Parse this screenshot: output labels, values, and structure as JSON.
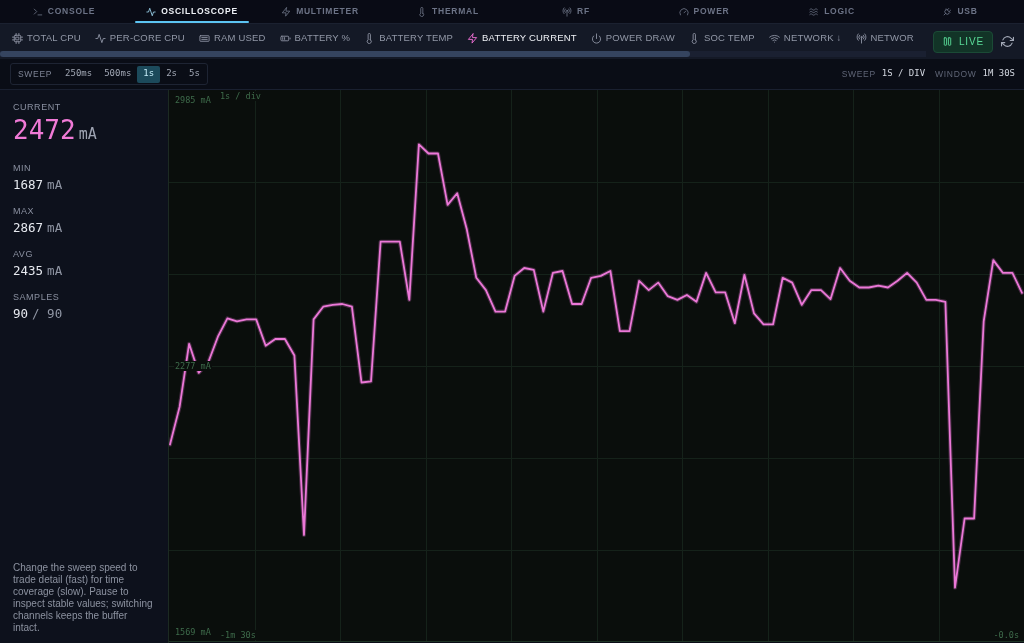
{
  "nav_tabs": [
    {
      "label": "CONSOLE",
      "selected": false
    },
    {
      "label": "OSCILLOSCOPE",
      "selected": true
    },
    {
      "label": "MULTIMETER",
      "selected": false
    },
    {
      "label": "THERMAL",
      "selected": false
    },
    {
      "label": "RF",
      "selected": false
    },
    {
      "label": "POWER",
      "selected": false
    },
    {
      "label": "LOGIC",
      "selected": false
    },
    {
      "label": "USB",
      "selected": false
    }
  ],
  "channels": [
    {
      "label": "TOTAL CPU",
      "selected": false
    },
    {
      "label": "PER-CORE CPU",
      "selected": false
    },
    {
      "label": "RAM USED",
      "selected": false
    },
    {
      "label": "BATTERY %",
      "selected": false
    },
    {
      "label": "BATTERY TEMP",
      "selected": false
    },
    {
      "label": "BATTERY CURRENT",
      "selected": true
    },
    {
      "label": "POWER DRAW",
      "selected": false
    },
    {
      "label": "SOC TEMP",
      "selected": false
    },
    {
      "label": "NETWORK ↓",
      "selected": false
    },
    {
      "label": "NETWOR",
      "selected": false
    }
  ],
  "live_button": {
    "label": "LIVE",
    "active": true
  },
  "sweep": {
    "label": "SWEEP",
    "options": [
      {
        "label": "250ms",
        "selected": false
      },
      {
        "label": "500ms",
        "selected": false
      },
      {
        "label": "1s",
        "selected": true
      },
      {
        "label": "2s",
        "selected": false
      },
      {
        "label": "5s",
        "selected": false
      }
    ]
  },
  "scale_info": [
    {
      "label": "SWEEP",
      "value": "1S / DIV"
    },
    {
      "label": "WINDOW",
      "value": "1M 30S"
    }
  ],
  "stats": {
    "current": {
      "label": "CURRENT",
      "value": "2472",
      "unit": "mA"
    },
    "items": [
      {
        "label": "MIN",
        "value": "1687",
        "unit": "mA"
      },
      {
        "label": "MAX",
        "value": "2867",
        "unit": "mA"
      },
      {
        "label": "AVG",
        "value": "2435",
        "unit": "mA"
      },
      {
        "label": "SAMPLES",
        "value": "90",
        "unit": "/ 90"
      }
    ]
  },
  "help_text": "Change the sweep speed to trade detail (fast) for time coverage (slow). Pause to inspect stable values; switching channels keeps the buffer intact.",
  "chart": {
    "time_labels": [
      "-1m 30s",
      "-0.0s"
    ],
    "chart_data": {
      "type": "line",
      "ylim": [
        1542,
        3012
      ],
      "yticks": [
        {
          "value": 2985,
          "label": "2985 mA"
        },
        {
          "value": 2277,
          "label": "2277 mA"
        },
        {
          "value": 1569,
          "label": "1569 mA"
        }
      ],
      "annotations": [
        {
          "text": "1s / div"
        }
      ],
      "series": [
        {
          "color": "#ec78d8",
          "values": [
            2068,
            2168,
            2336,
            2259,
            2287,
            2355,
            2404,
            2396,
            2401,
            2401,
            2331,
            2349,
            2349,
            2305,
            1827,
            2401,
            2435,
            2440,
            2442,
            2435,
            2233,
            2236,
            2608,
            2608,
            2608,
            2453,
            2867,
            2843,
            2843,
            2706,
            2737,
            2641,
            2512,
            2479,
            2422,
            2422,
            2517,
            2538,
            2533,
            2422,
            2525,
            2530,
            2442,
            2442,
            2512,
            2517,
            2530,
            2370,
            2370,
            2504,
            2479,
            2499,
            2463,
            2453,
            2466,
            2448,
            2525,
            2473,
            2473,
            2391,
            2520,
            2417,
            2388,
            2388,
            2512,
            2499,
            2440,
            2479,
            2479,
            2455,
            2538,
            2504,
            2486,
            2486,
            2491,
            2486,
            2504,
            2525,
            2499,
            2453,
            2453,
            2448,
            1687,
            1871,
            1871,
            2396,
            2559,
            2525,
            2525,
            2472
          ]
        }
      ]
    }
  }
}
